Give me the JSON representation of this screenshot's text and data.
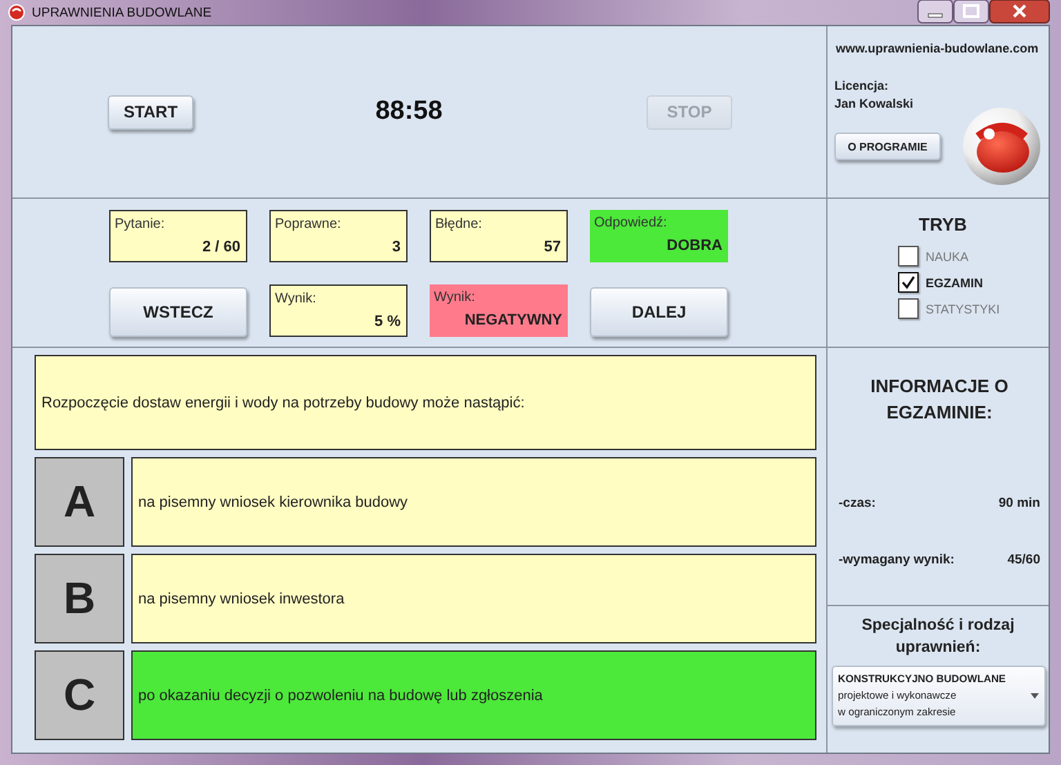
{
  "window": {
    "title": "UPRAWNIENIA BUDOWLANE"
  },
  "timer_bar": {
    "start_button": {
      "label": "START",
      "disabled": false
    },
    "time": "88:58",
    "stop_button": {
      "label": "STOP",
      "disabled": true
    }
  },
  "about": {
    "website": "www.uprawnienia-budowlane.com",
    "license_label": "Licencja:",
    "license_holder": "Jan Kowalski",
    "about_button": "O PROGRAMIE"
  },
  "stat_grid": [
    {
      "kind": "stat",
      "label": "Pytanie:",
      "value": "2 / 60",
      "color": "#fffdc2",
      "outlined": true
    },
    {
      "kind": "stat",
      "label": "Poprawne:",
      "value": "3",
      "color": "#fffdc2",
      "outlined": true
    },
    {
      "kind": "stat",
      "label": "Błędne:",
      "value": "57",
      "color": "#fffdc2",
      "outlined": true
    },
    {
      "kind": "stat",
      "label": "Odpowiedź:",
      "value": "DOBRA",
      "color": "#4ce83a",
      "outlined": false
    },
    {
      "kind": "button",
      "label": "WSTECZ"
    },
    {
      "kind": "stat",
      "label": "Wynik:",
      "value": "5 %",
      "color": "#fffdc2",
      "outlined": true
    },
    {
      "kind": "stat",
      "label": "Wynik:",
      "value": "NEGATYWNY",
      "color": "#ff7b8c",
      "outlined": false
    },
    {
      "kind": "button",
      "label": "DALEJ"
    }
  ],
  "mode": {
    "title": "TRYB",
    "options": [
      {
        "label": "NAUKA",
        "checked": false
      },
      {
        "label": "EGZAMIN",
        "checked": true
      },
      {
        "label": "STATYSTYKI",
        "checked": false
      }
    ]
  },
  "question": {
    "text": "Rozpoczęcie dostaw energii i wody na potrzeby budowy może nastąpić:",
    "answers": [
      {
        "letter": "A",
        "text": "na pisemny wniosek kierownika budowy",
        "correct": false
      },
      {
        "letter": "B",
        "text": "na pisemny wniosek inwestora",
        "correct": false
      },
      {
        "letter": "C",
        "text": "po okazaniu decyzji o pozwoleniu na budowę lub zgłoszenia",
        "correct": true
      }
    ]
  },
  "exam_info": {
    "title": "INFORMACJE O EGZAMINIE:",
    "rows": [
      {
        "label": "-czas:",
        "value": "90 min"
      },
      {
        "label": "-wymagany wynik:",
        "value": "45/60"
      }
    ]
  },
  "specialty": {
    "title": "Specjalność i rodzaj uprawnień:",
    "selection": [
      "KONSTRUKCYJNO BUDOWLANE",
      "projektowe i wykonawcze",
      "w ograniczonym zakresie"
    ]
  }
}
